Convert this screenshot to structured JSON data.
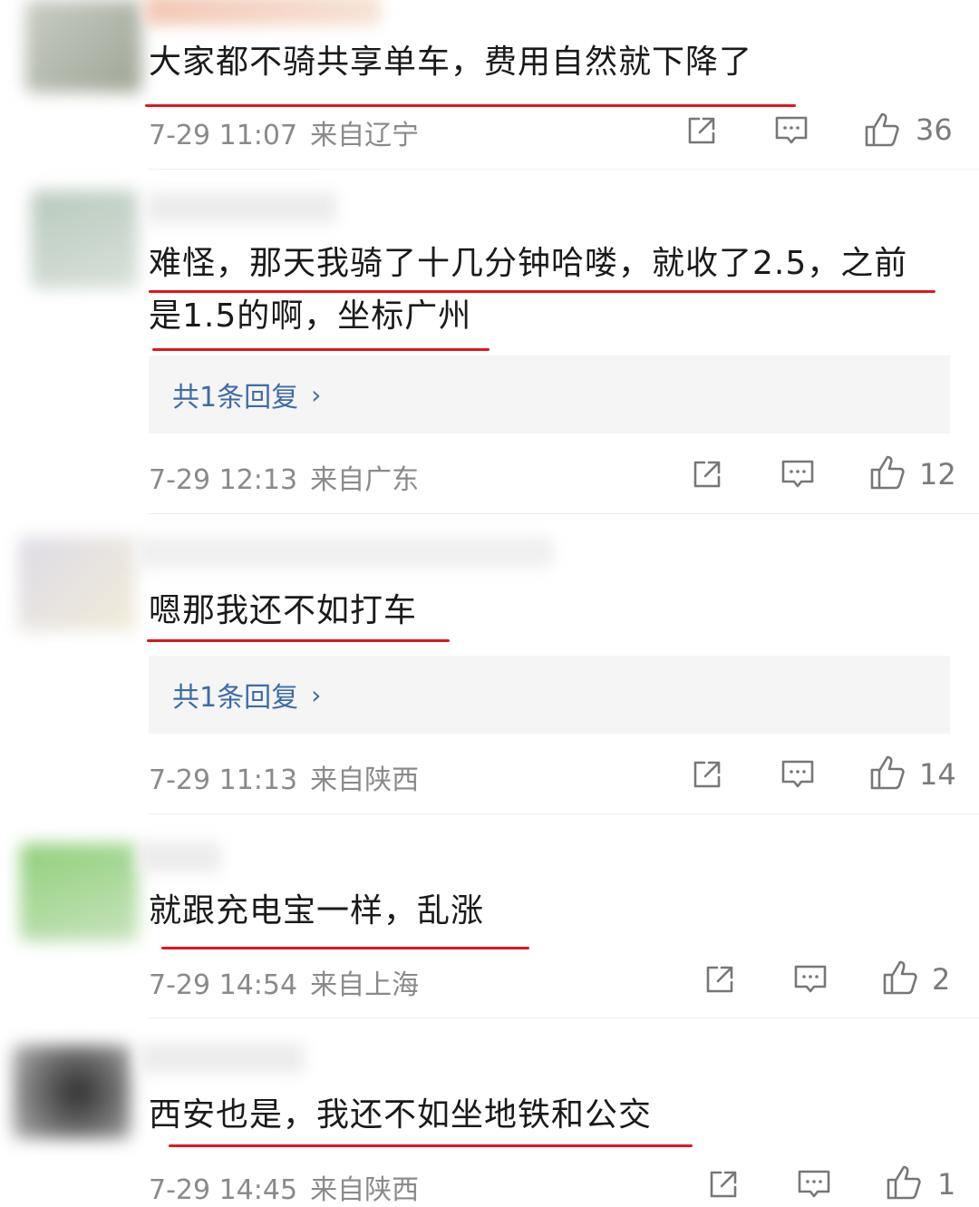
{
  "comments": [
    {
      "text_lines": [
        "大家都不骑共享单车，费用自然就下降了"
      ],
      "time": "7-29 11:07",
      "location": "来自辽宁",
      "likes": "36",
      "reply": null
    },
    {
      "text_lines": [
        "难怪，那天我骑了十几分钟哈喽，就收了2.5，之前",
        "是1.5的啊，坐标广州"
      ],
      "time": "7-29 12:13",
      "location": "来自广东",
      "likes": "12",
      "reply": "共1条回复"
    },
    {
      "text_lines": [
        "嗯那我还不如打车"
      ],
      "time": "7-29 11:13",
      "location": "来自陕西",
      "likes": "14",
      "reply": "共1条回复"
    },
    {
      "text_lines": [
        "就跟充电宝一样，乱涨"
      ],
      "time": "7-29 14:54",
      "location": "来自上海",
      "likes": "2",
      "reply": null
    },
    {
      "text_lines": [
        "西安也是，我还不如坐地铁和公交"
      ],
      "time": "7-29 14:45",
      "location": "来自陕西",
      "likes": "1",
      "reply": null
    }
  ],
  "reply_chevron": "›",
  "icons": {
    "share": "share-icon",
    "comment": "comment-icon",
    "like": "thumbs-up-icon"
  },
  "colors": {
    "underline": "#e0161f",
    "reply_link": "#3d6ca7",
    "meta": "#8a8a8a"
  }
}
